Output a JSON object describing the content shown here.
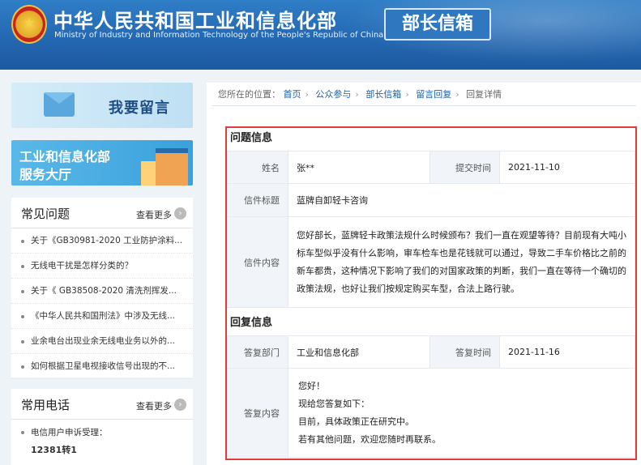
{
  "header": {
    "site_title": "中华人民共和国工业和信息化部",
    "site_subtitle": "Ministry of Industry and Information Technology of the People's Republic of China",
    "box_title": "部长信箱"
  },
  "sidebar": {
    "banner_message": "我要留言",
    "banner_hall_line1": "工业和信息化部",
    "banner_hall_line2": "服务大厅",
    "faq": {
      "title": "常见问题",
      "more": "查看更多",
      "items": [
        "关于《GB30981-2020 工业防护涂料...",
        "无线电干扰是怎样分类的？",
        "关于《 GB38508-2020 清洗剂挥发...",
        "《中华人民共和国刑法》中涉及无线...",
        "业余电台出现业余无线电业务以外的...",
        "如何根据卫星电视接收信号出现的不..."
      ]
    },
    "phone": {
      "title": "常用电话",
      "more": "查看更多",
      "item_label": "电信用户申诉受理：",
      "item_number": "12381转1"
    }
  },
  "breadcrumb": {
    "prefix": "您所在的位置：",
    "items": [
      "首页",
      "公众参与",
      "部长信箱",
      "留言回复"
    ],
    "current": "回复详情"
  },
  "question": {
    "section_title": "问题信息",
    "name_label": "姓名",
    "name_value": "张**",
    "time_label": "提交时间",
    "time_value": "2021-11-10",
    "subject_label": "信件标题",
    "subject_value": "蓝牌自卸轻卡咨询",
    "content_label": "信件内容",
    "content_value": "您好部长，蓝牌轻卡政策法规什么时候颁布？我们一直在观望等待？目前现有大吨小标车型似乎没有什么影响，审车检车也是花钱就可以通过，导致二手车价格比之前的新车都贵，这种情况下影响了我们的对国家政策的判断，我们一直在等待一个确切的政策法规，也好让我们按规定购买车型，合法上路行驶。"
  },
  "reply": {
    "section_title": "回复信息",
    "dept_label": "答复部门",
    "dept_value": "工业和信息化部",
    "time_label": "答复时间",
    "time_value": "2021-11-16",
    "content_label": "答复内容",
    "lines": [
      "您好！",
      "现给您答复如下：",
      "目前，具体政策正在研究中。",
      "若有其他问题，欢迎您随时再联系。"
    ]
  }
}
